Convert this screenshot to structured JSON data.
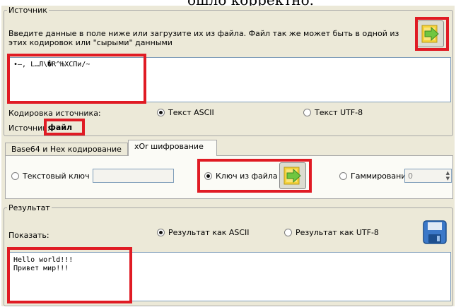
{
  "caption_fragment": "ошло корректно.",
  "source": {
    "legend": "Источник",
    "description": "Введите данные в поле ниже или загрузите их из файла. Файл так же может быть в одной из этих кодировок или \"сырыми\" данными",
    "input_value": "•–, L…Л\\�R^ЊXСПи/~",
    "encoding_label": "Кодировка источника:",
    "encoding_options": [
      "Текст ASCII",
      "Текст UTF-8"
    ],
    "selected_encoding": "Текст ASCII",
    "source_label": "Источник:",
    "source_value": "файл",
    "load_icon": "open-file-arrow-icon"
  },
  "tabs": [
    {
      "label": "Base64 и Hex кодирование",
      "active": false
    },
    {
      "label": "xOr шифрование",
      "active": true
    }
  ],
  "xor": {
    "text_key_label": "Текстовый ключ",
    "text_key_value": "",
    "file_key_label": "Ключ из файла",
    "gamma_label": "Гаммирование",
    "gamma_value": "0",
    "selected": "Ключ из файла",
    "load_icon": "open-file-arrow-icon"
  },
  "result": {
    "legend": "Результат",
    "show_label": "Показать:",
    "options": [
      "Результат как ASCII",
      "Результат как UTF-8"
    ],
    "selected": "Результат как ASCII",
    "output_lines": [
      "Hello world!!!",
      "Привет мир!!!"
    ],
    "save_icon": "floppy-disk-icon"
  },
  "colors": {
    "highlight": "#e01b24",
    "icon_green": "#6fc640",
    "icon_yellow": "#f5d23a",
    "floppy_blue": "#3b78c8",
    "window_bg": "#ece9d8"
  }
}
